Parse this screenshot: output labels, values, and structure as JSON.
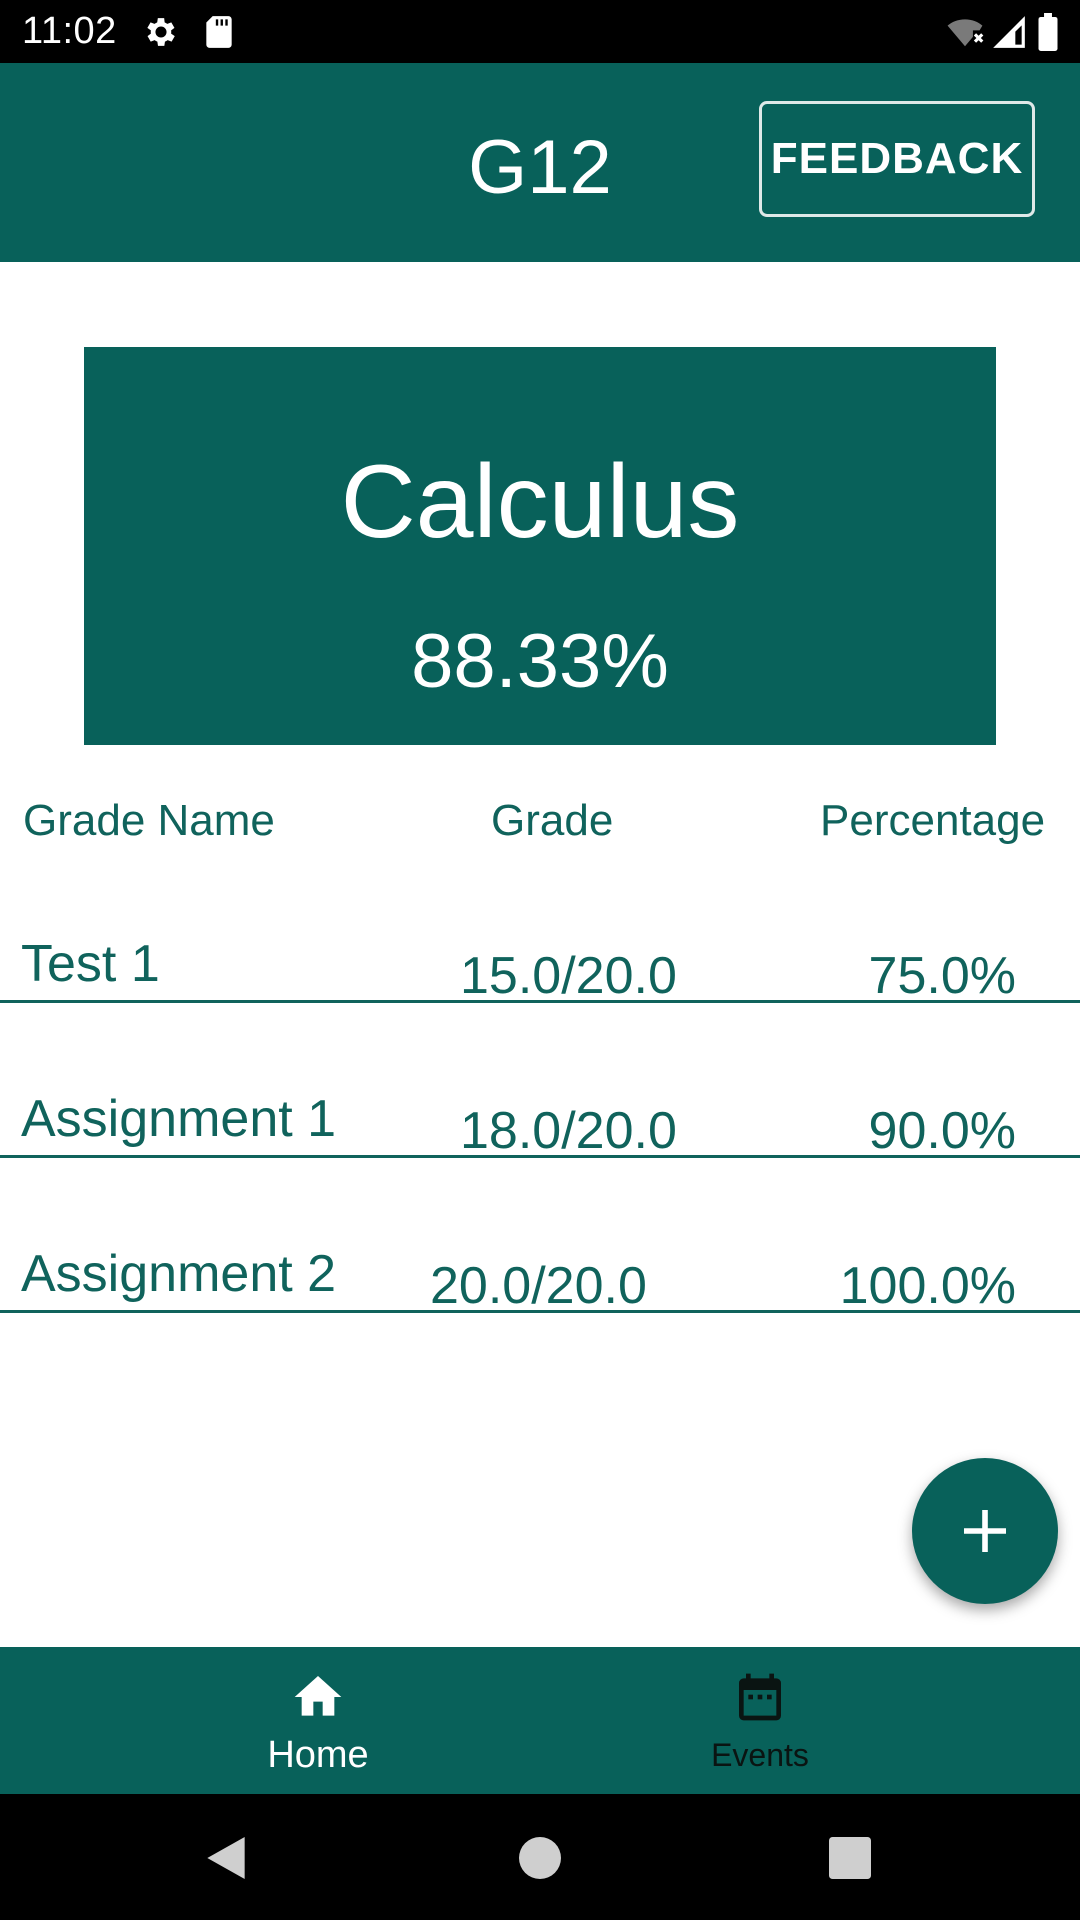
{
  "status_bar": {
    "time": "11:02",
    "icons": [
      "settings-gear-icon",
      "sd-card-icon",
      "wifi-no-internet-icon",
      "cell-signal-icon",
      "battery-icon"
    ]
  },
  "app_bar": {
    "title": "G12",
    "feedback_label": "FEEDBACK"
  },
  "course": {
    "name": "Calculus",
    "average": "88.33%"
  },
  "table": {
    "headers": {
      "name": "Grade Name",
      "grade": "Grade",
      "percentage": "Percentage"
    },
    "rows": [
      {
        "name": "Test 1",
        "grade": "15.0/20.0",
        "percentage": "75.0%"
      },
      {
        "name": "Assignment 1",
        "grade": "18.0/20.0",
        "percentage": "90.0%"
      },
      {
        "name": "Assignment 2",
        "grade": "20.0/20.0",
        "percentage": "100.0%"
      }
    ]
  },
  "fab": {
    "icon": "plus-icon"
  },
  "bottom_nav": {
    "items": [
      {
        "label": "Home",
        "icon": "home-icon",
        "selected": true
      },
      {
        "label": "Events",
        "icon": "calendar-icon",
        "selected": false
      }
    ]
  },
  "system_nav": {
    "icons": [
      "back-icon",
      "home-circle-icon",
      "recents-icon"
    ]
  },
  "colors": {
    "primary": "#08615a",
    "text_primary": "#10635c",
    "on_primary": "#ffffff"
  }
}
